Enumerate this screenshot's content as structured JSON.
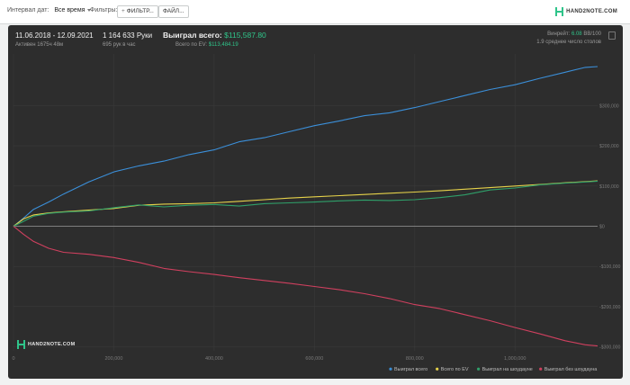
{
  "toolbar": {
    "interval_label": "Интервал дат:",
    "interval_value": "Все время",
    "filters_label": "Фильтры:",
    "filter_button": "ФИЛЬТР...",
    "file_button": "ФАЙЛ...",
    "logo_text": "HAND2NOTE.COM"
  },
  "summary": {
    "date_range": "11.06.2018 - 12.09.2021",
    "active": "Активен 1675ч 48м",
    "hands": "1 164 633 Руки",
    "hands_per_hour": "695 рук в час",
    "won_total_label": "Выиграл всего:",
    "won_total_value": "$115,587.80",
    "ev_total_label": "Всего по EV:",
    "ev_total_value": "$113,484.19",
    "winrate_label": "Винрейт:",
    "winrate_value": "6.08",
    "winrate_unit": "BB/100",
    "avg_tables": "1.9 среднее число столов"
  },
  "colors": {
    "won": "#3b8fd9",
    "ev": "#e6d24a",
    "showdown": "#2fa06a",
    "non_showdown": "#d0405f",
    "accent": "#2fc48a"
  },
  "chart_data": {
    "type": "line",
    "xlim": [
      0,
      1164633
    ],
    "ylim": [
      -310000,
      415000
    ],
    "x_ticks": [
      0,
      200000,
      400000,
      600000,
      800000,
      1000000
    ],
    "x_tick_labels": [
      "0",
      "200,000",
      "400,000",
      "600,000",
      "800,000",
      "1,000,000"
    ],
    "y_ticks": [
      300000,
      200000,
      100000,
      0,
      -100000,
      -200000,
      -300000
    ],
    "y_tick_labels": [
      "$300,000",
      "$200,000",
      "$100,000",
      "$0",
      "-$100,000",
      "-$200,000",
      "-$300,000"
    ],
    "legend_position": "bottom-right",
    "series": [
      {
        "name": "Выиграл всего",
        "color_key": "won",
        "x": [
          0,
          20000,
          40000,
          70000,
          100000,
          150000,
          200000,
          250000,
          300000,
          350000,
          400000,
          450000,
          500000,
          550000,
          600000,
          650000,
          700000,
          750000,
          800000,
          850000,
          900000,
          950000,
          1000000,
          1050000,
          1100000,
          1140000,
          1164633
        ],
        "y": [
          0,
          20000,
          42000,
          60000,
          80000,
          110000,
          135000,
          150000,
          162000,
          178000,
          190000,
          210000,
          220000,
          235000,
          250000,
          262000,
          275000,
          282000,
          295000,
          310000,
          325000,
          340000,
          352000,
          368000,
          383000,
          395000,
          397000
        ]
      },
      {
        "name": "Всего по EV",
        "color_key": "ev",
        "x": [
          0,
          20000,
          40000,
          70000,
          100000,
          150000,
          200000,
          250000,
          300000,
          350000,
          400000,
          450000,
          500000,
          550000,
          600000,
          650000,
          700000,
          750000,
          800000,
          850000,
          900000,
          950000,
          1000000,
          1050000,
          1100000,
          1140000,
          1164633
        ],
        "y": [
          0,
          18000,
          28000,
          33000,
          36000,
          40000,
          44000,
          52000,
          55000,
          56000,
          58000,
          62000,
          66000,
          70000,
          73000,
          76000,
          79000,
          82000,
          85000,
          88000,
          92000,
          96000,
          100000,
          104000,
          108000,
          111000,
          113000
        ]
      },
      {
        "name": "Выиграл на шоудауне",
        "color_key": "showdown",
        "x": [
          0,
          20000,
          40000,
          70000,
          100000,
          150000,
          200000,
          250000,
          300000,
          350000,
          400000,
          450000,
          500000,
          550000,
          600000,
          650000,
          700000,
          750000,
          800000,
          850000,
          900000,
          950000,
          1000000,
          1050000,
          1100000,
          1140000,
          1164633
        ],
        "y": [
          0,
          12000,
          25000,
          32000,
          35000,
          38000,
          46000,
          53000,
          48000,
          52000,
          54000,
          50000,
          56000,
          58000,
          60000,
          63000,
          65000,
          64000,
          66000,
          71000,
          78000,
          90000,
          95000,
          103000,
          107000,
          110000,
          112000
        ]
      },
      {
        "name": "Выиграл без шоудауна",
        "color_key": "non_showdown",
        "x": [
          0,
          20000,
          40000,
          70000,
          100000,
          150000,
          200000,
          250000,
          300000,
          350000,
          400000,
          450000,
          500000,
          550000,
          600000,
          650000,
          700000,
          750000,
          800000,
          850000,
          900000,
          950000,
          1000000,
          1050000,
          1100000,
          1140000,
          1164633
        ],
        "y": [
          0,
          -20000,
          -38000,
          -55000,
          -65000,
          -70000,
          -78000,
          -90000,
          -105000,
          -113000,
          -120000,
          -128000,
          -135000,
          -142000,
          -150000,
          -158000,
          -168000,
          -180000,
          -195000,
          -205000,
          -220000,
          -235000,
          -252000,
          -268000,
          -285000,
          -295000,
          -298000
        ]
      }
    ]
  }
}
